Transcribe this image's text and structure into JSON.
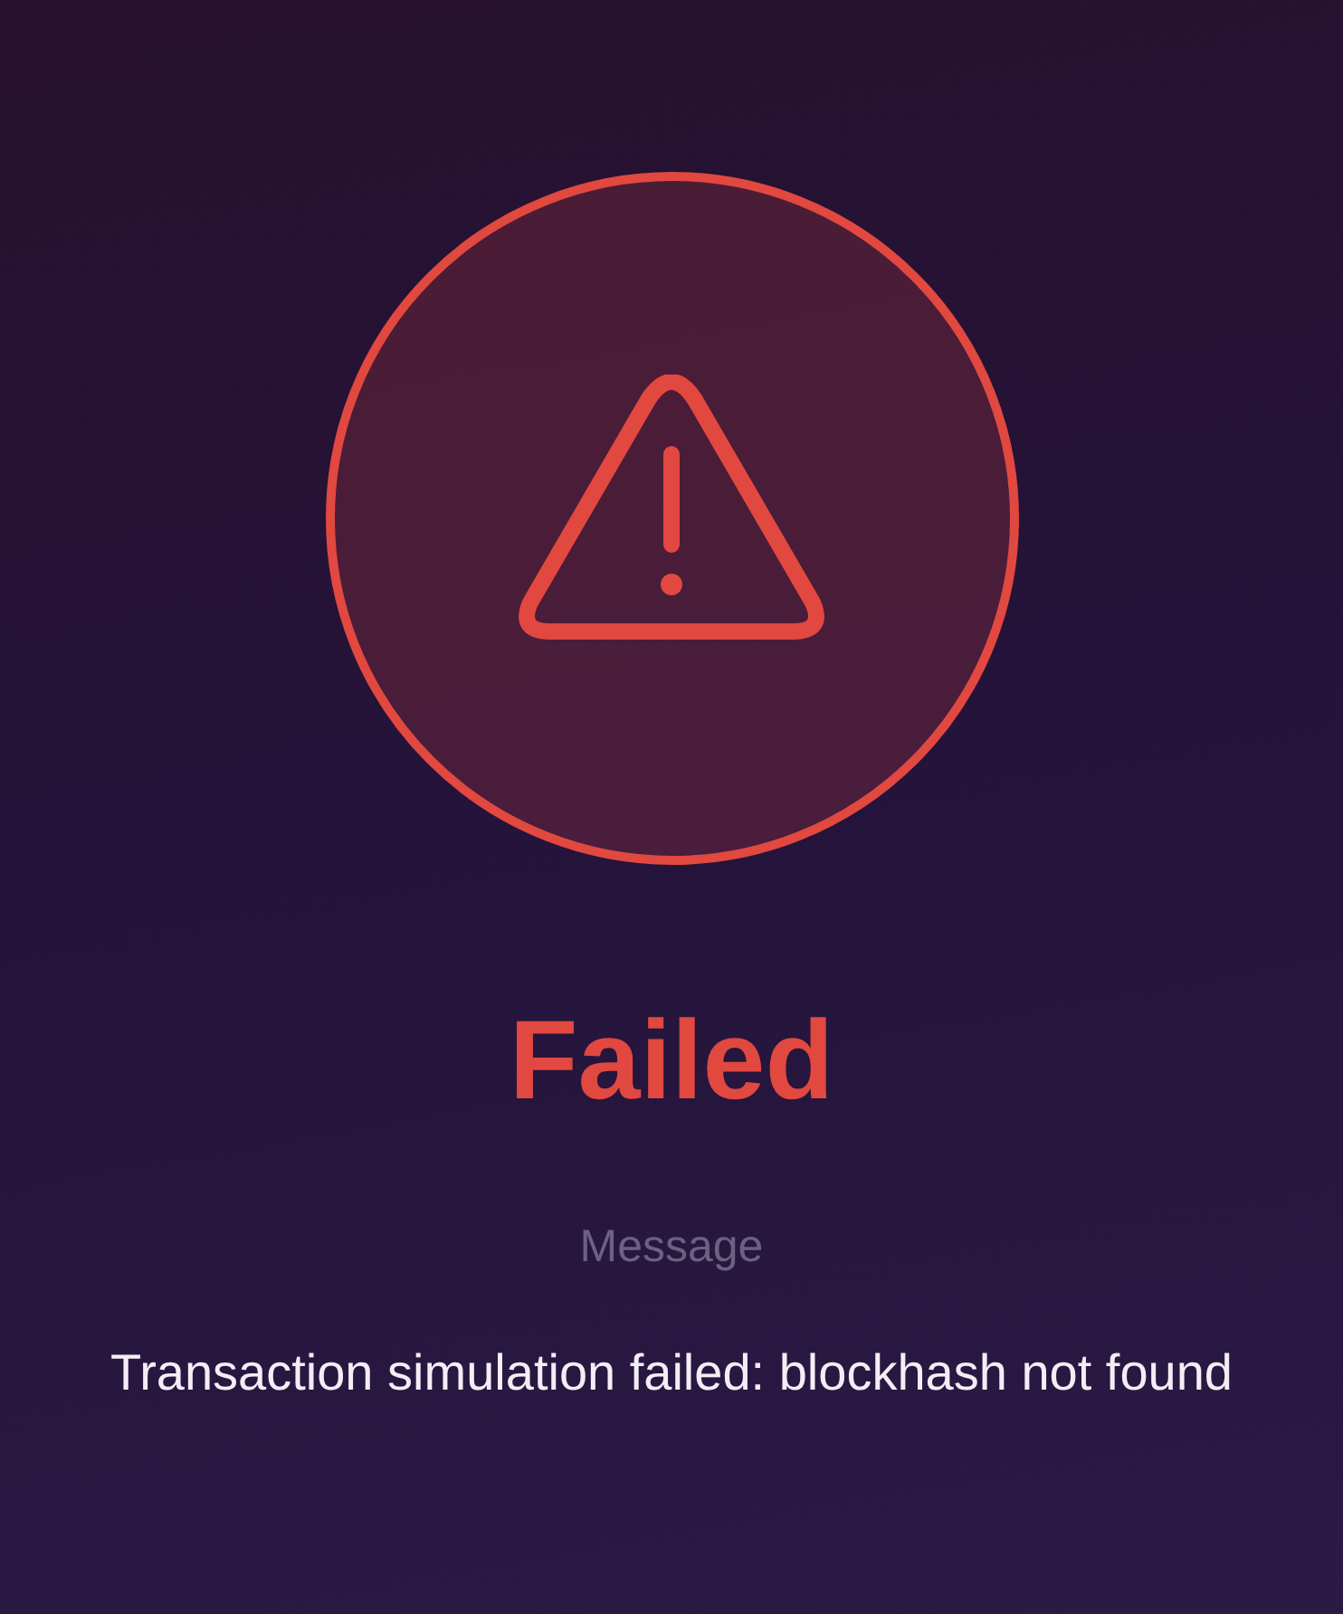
{
  "status": {
    "kind": "failed",
    "title": "Failed"
  },
  "message": {
    "label": "Message",
    "text": "Transaction simulation failed: blockhash not found"
  }
}
